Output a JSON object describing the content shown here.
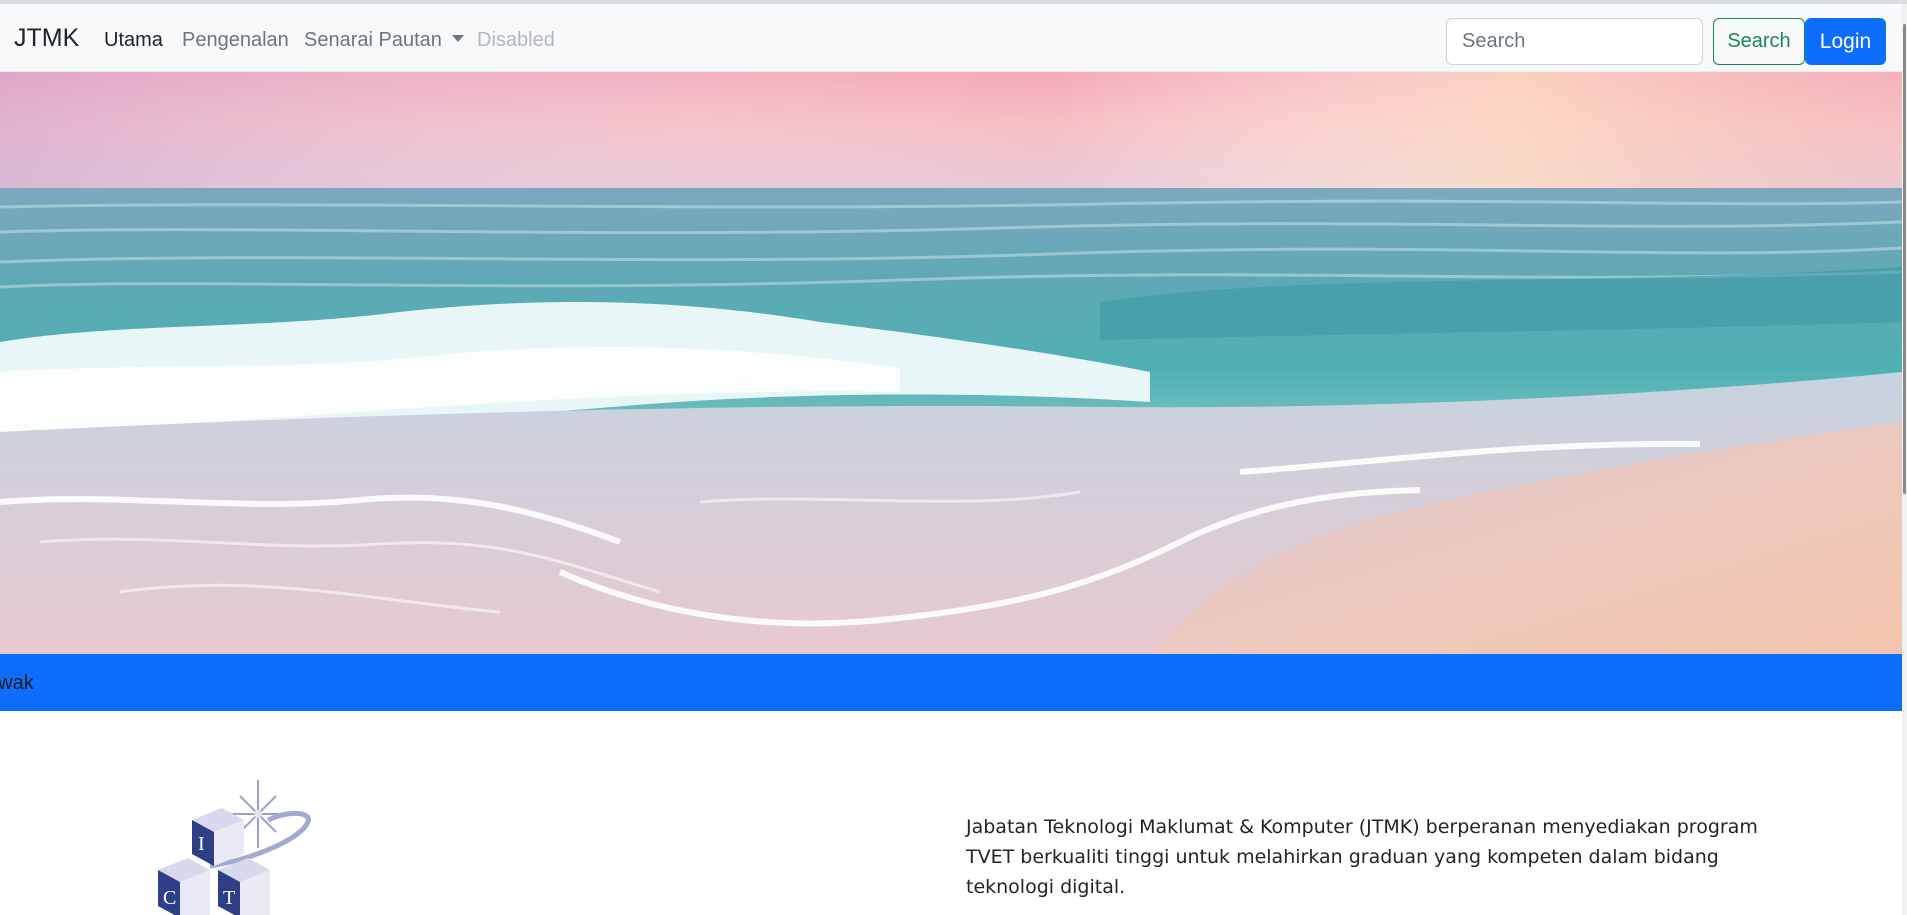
{
  "navbar": {
    "brand": "JTMK",
    "links": [
      {
        "label": "Utama",
        "state": "active"
      },
      {
        "label": "Pengenalan",
        "state": "normal"
      },
      {
        "label": "Senarai Pautan",
        "state": "dropdown"
      },
      {
        "label": "Disabled",
        "state": "disabled"
      }
    ],
    "search": {
      "placeholder": "Search",
      "value": ""
    },
    "search_button": "Search",
    "login_button": "Login"
  },
  "hero": {
    "image": "beach-waves-sunset"
  },
  "marquee": {
    "text": "awak"
  },
  "content": {
    "logo": "ict-cubes-logo",
    "logo_letters": [
      "I",
      "C",
      "T"
    ],
    "description": "Jabatan Teknologi Maklumat & Komputer (JTMK) berperanan menyediakan program TVET berkualiti tinggi untuk melahirkan graduan yang kompeten dalam bidang teknologi digital."
  },
  "colors": {
    "navbar_bg": "#f8f9fa",
    "primary": "#0d6efd",
    "success": "#198754",
    "text": "#212529",
    "muted": "#6c757d"
  }
}
